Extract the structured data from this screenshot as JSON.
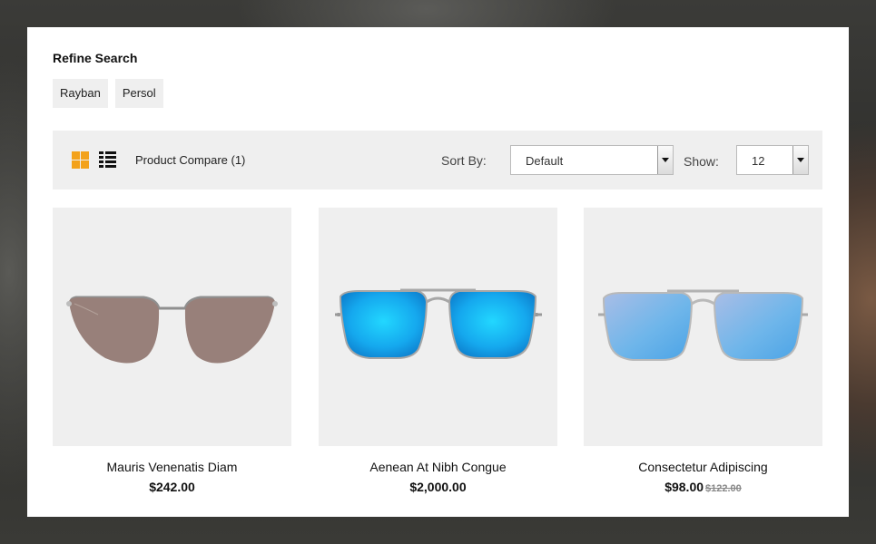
{
  "refine": {
    "title": "Refine Search",
    "filters": [
      "Rayban",
      "Persol"
    ]
  },
  "toolbar": {
    "grid_view_icon": "grid-icon",
    "list_view_icon": "list-icon",
    "compare_label": "Product Compare (1)",
    "sort_label": "Sort By:",
    "sort_value": "Default",
    "show_label": "Show:",
    "show_value": "12",
    "accent_color": "#f3a21b"
  },
  "products": [
    {
      "name": "Mauris Venenatis Diam",
      "price": "$242.00",
      "old_price": ""
    },
    {
      "name": "Aenean At Nibh Congue",
      "price": "$2,000.00",
      "old_price": ""
    },
    {
      "name": "Consectetur Adipiscing",
      "price": "$98.00",
      "old_price": "$122.00"
    }
  ]
}
